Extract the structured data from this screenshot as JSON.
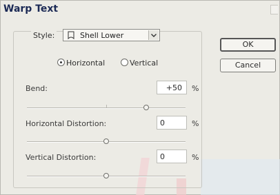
{
  "window": {
    "title": "Warp Text"
  },
  "style": {
    "label": "Style:",
    "selected": "Shell Lower"
  },
  "orientation": {
    "horizontal": "Horizontal",
    "vertical": "Vertical",
    "selected": "horizontal"
  },
  "bend": {
    "label": "Bend:",
    "value": "+50",
    "unit": "%",
    "level": 0.75
  },
  "horizontal_distortion": {
    "label": "Horizontal Distortion:",
    "value": "0",
    "unit": "%",
    "level": 0.5
  },
  "vertical_distortion": {
    "label": "Vertical Distortion:",
    "value": "0",
    "unit": "%",
    "level": 0.5
  },
  "buttons": {
    "ok": "OK",
    "cancel": "Cancel"
  },
  "colors": {
    "title": "#1c2a55",
    "dialog_bg": "#ecebe5"
  }
}
